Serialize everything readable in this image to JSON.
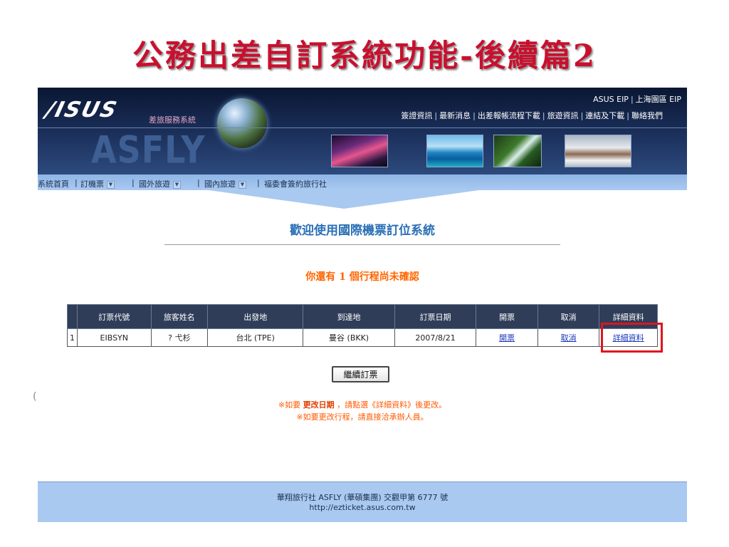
{
  "slide": {
    "title": "公務出差自訂系統功能-後續篇2"
  },
  "header": {
    "logo_asus": "/ISUS",
    "logo_sub": "差旅服務系統",
    "logo_asfly": "ASFLY",
    "top_links": [
      "ASUS EIP",
      "上海園區 EIP"
    ],
    "sub_links": [
      "簽證資訊",
      "最新消息",
      "出差報帳流程下載",
      "旅遊資訊",
      "連結及下載",
      "聯絡我們"
    ]
  },
  "nav": {
    "items": [
      {
        "label": "系統首頁",
        "dropdown": false
      },
      {
        "label": "訂機票",
        "dropdown": true
      },
      {
        "label": "國外旅遊",
        "dropdown": true
      },
      {
        "label": "國內旅遊",
        "dropdown": true
      },
      {
        "label": "福委會簽約旅行社",
        "dropdown": false
      }
    ],
    "separator": "|"
  },
  "main": {
    "heading": "歡迎使用國際機票訂位系統",
    "notice": "你還有 1 個行程尚未確認",
    "table": {
      "columns": [
        "",
        "訂票代號",
        "旅客姓名",
        "出發地",
        "到達地",
        "訂票日期",
        "開票",
        "取消",
        "詳細資料"
      ],
      "rows": [
        {
          "index": "1",
          "code": "EIBSYN",
          "name": "? 弋杉",
          "from": "台北 (TPE)",
          "to": "曼谷 (BKK)",
          "date": "2007/8/21",
          "issue": "開票",
          "cancel": "取消",
          "detail": "詳細資料"
        }
      ]
    },
    "continue_button": "繼續訂票",
    "note1_prefix": "※如要 ",
    "note1_bold": "更改日期",
    "note1_suffix": " ，請點選《詳細資料》後更改。",
    "note2": "※如要更改行程，請直接洽承辦人員。"
  },
  "footer": {
    "line1": "華翔旅行社 ASFLY (華碩集團) 交觀甲第 6777 號",
    "line2": "http://ezticket.asus.com.tw"
  },
  "stray_mark": "("
}
